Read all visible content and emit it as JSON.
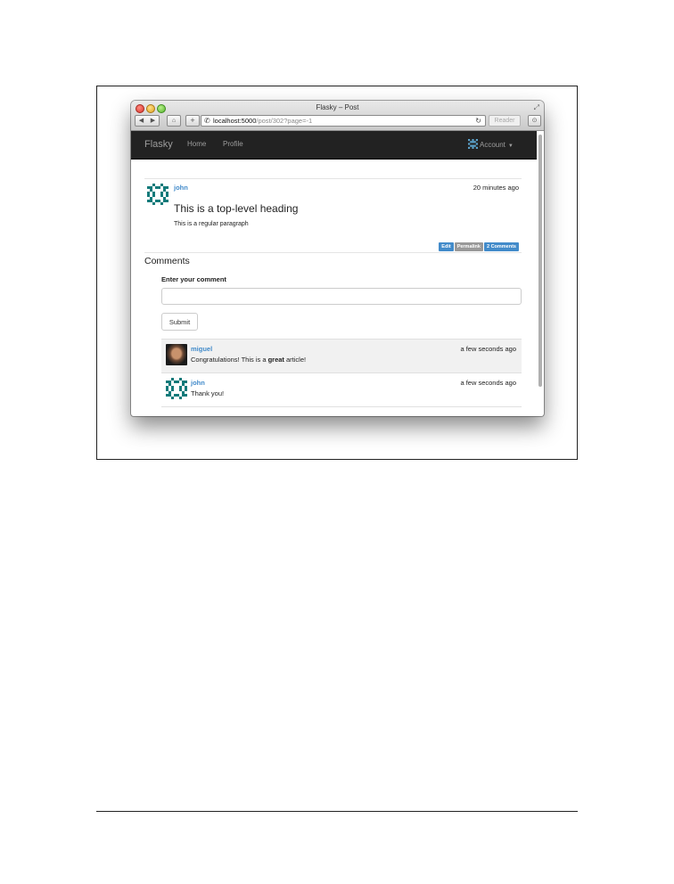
{
  "browser": {
    "window_title": "Flasky – Post",
    "url_host": "localhost:5000",
    "url_path": "/post/302?page=-1",
    "reader_label": "Reader"
  },
  "navbar": {
    "brand": "Flasky",
    "links": [
      {
        "label": "Home"
      },
      {
        "label": "Profile"
      }
    ],
    "account_label": "Account"
  },
  "post": {
    "author": "john",
    "timestamp": "20 minutes ago",
    "heading": "This is a top-level heading",
    "paragraph": "This is a regular paragraph",
    "actions": [
      {
        "label": "Edit",
        "color": "#428bca"
      },
      {
        "label": "Permalink",
        "color": "#999999"
      },
      {
        "label": "2 Comments",
        "color": "#428bca"
      }
    ]
  },
  "comments_section": {
    "heading": "Comments",
    "form_label": "Enter your comment",
    "input_value": "",
    "submit_label": "Submit"
  },
  "comments": [
    {
      "author": "miguel",
      "timestamp": "a few seconds ago",
      "body_before": "Congratulations! This is a ",
      "body_bold": "great",
      "body_after": " article!",
      "avatar": "photo-avatar",
      "highlighted": true
    },
    {
      "author": "john",
      "timestamp": "a few seconds ago",
      "body_before": "Thank you!",
      "body_bold": "",
      "body_after": "",
      "avatar": "identicon-avatar",
      "highlighted": false
    }
  ],
  "colors": {
    "navbar_bg": "#222222",
    "link": "#428bca",
    "identicon": "#117a7a"
  }
}
